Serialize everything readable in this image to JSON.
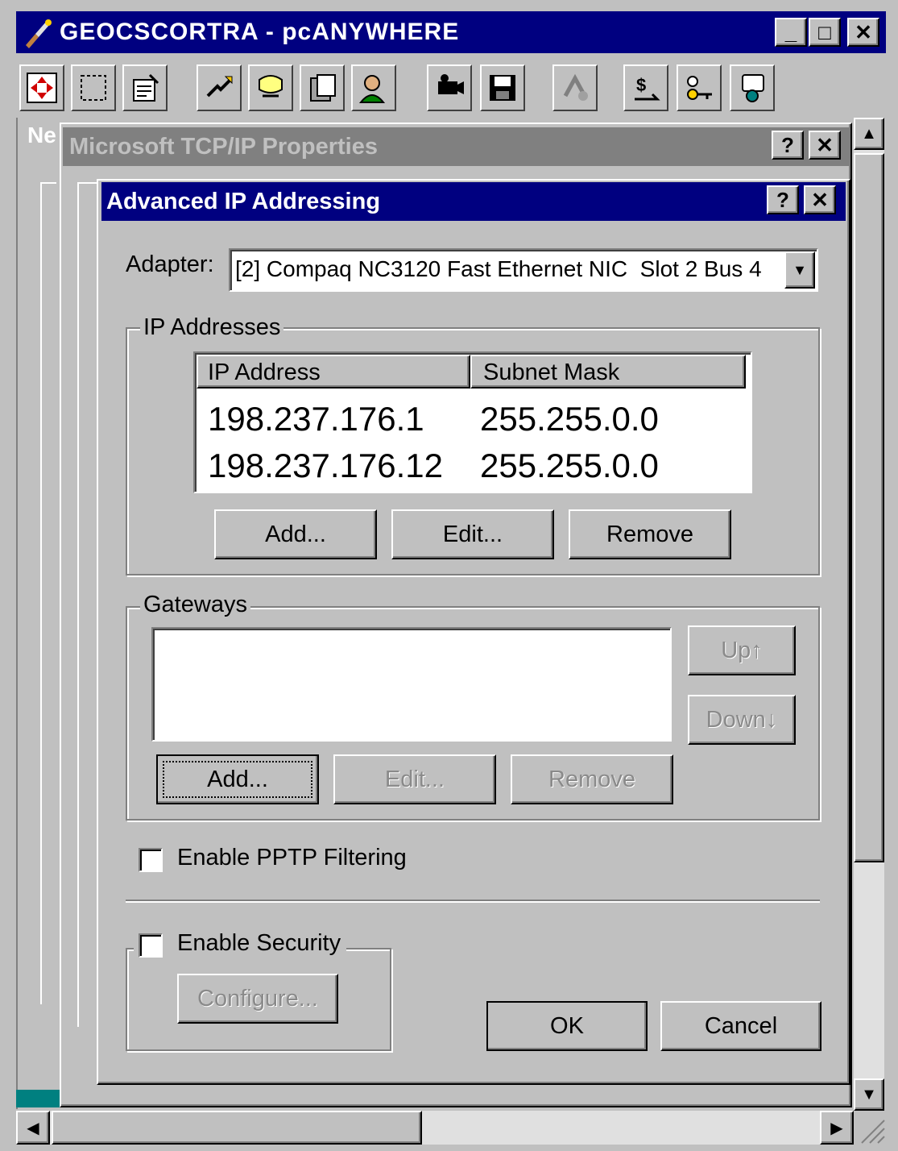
{
  "main_window": {
    "title": "GEOCSCORTRA - pcANYWHERE",
    "minimize": "_",
    "maximize": "□",
    "close": "✕"
  },
  "toolbar": {
    "icons": [
      "move-icon",
      "select-icon",
      "properties-icon",
      "transfer-icon",
      "chat-icon",
      "clipboard-icon",
      "user-icon",
      "camera-icon",
      "save-icon",
      "connection-icon",
      "file-transfer-icon",
      "key-icon",
      "help-icon"
    ]
  },
  "back_window_label": "Ne",
  "tcpip_dialog": {
    "title": "Microsoft TCP/IP Properties",
    "help": "?",
    "close": "✕"
  },
  "advanced_dialog": {
    "title": "Advanced IP Addressing",
    "help": "?",
    "close": "✕",
    "adapter_label": "Adapter:",
    "adapter_value": "[2] Compaq NC3120 Fast Ethernet NIC  Slot 2 Bus 4",
    "ip_group_label": "IP Addresses",
    "ip_table": {
      "headers": [
        "IP Address",
        "Subnet Mask"
      ],
      "rows": [
        {
          "ip": "198.237.176.1",
          "mask": "255.255.0.0"
        },
        {
          "ip": "198.237.176.12",
          "mask": "255.255.0.0"
        }
      ]
    },
    "ip_buttons": {
      "add": "Add...",
      "edit": "Edit...",
      "remove": "Remove"
    },
    "gateways_label": "Gateways",
    "gateway_buttons": {
      "up": "Up↑",
      "down": "Down↓",
      "add": "Add...",
      "edit": "Edit...",
      "remove": "Remove"
    },
    "pptp_label": "Enable PPTP Filtering",
    "security_label": "Enable Security",
    "configure_label": "Configure...",
    "ok_label": "OK",
    "cancel_label": "Cancel"
  }
}
